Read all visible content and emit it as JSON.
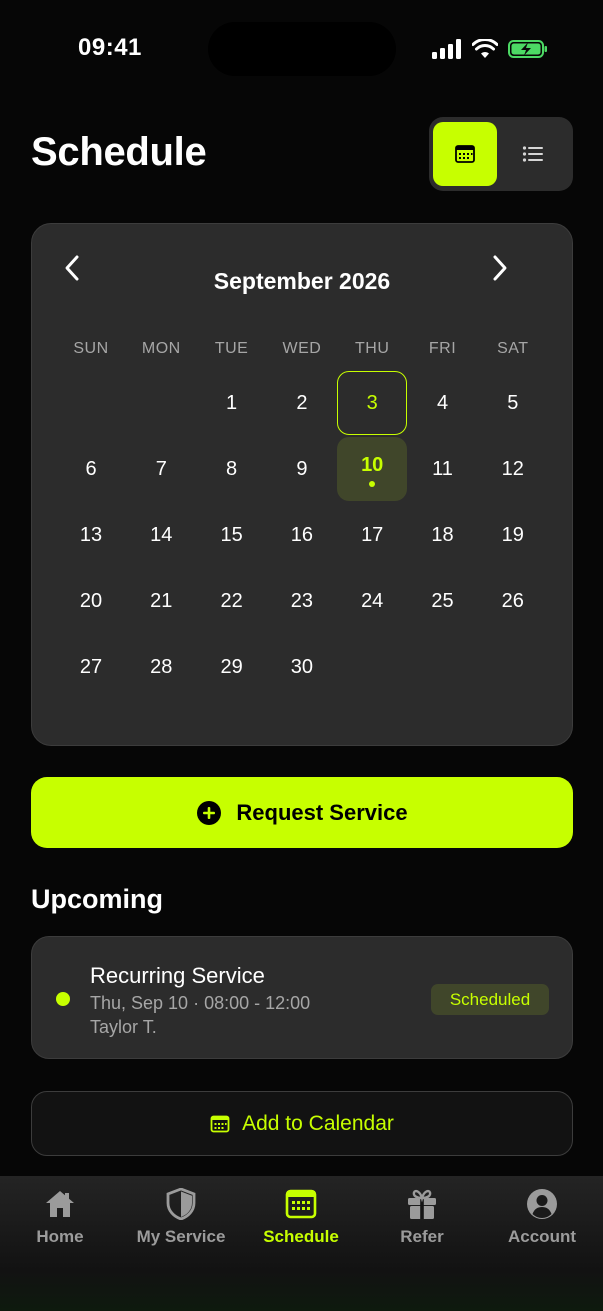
{
  "status_bar": {
    "time": "09:41"
  },
  "header": {
    "title": "Schedule"
  },
  "calendar": {
    "month_label": "September 2026",
    "weekdays": [
      "SUN",
      "MON",
      "TUE",
      "WED",
      "THU",
      "FRI",
      "SAT"
    ],
    "first_weekday_index": 2,
    "days_in_month": 30,
    "today": 3,
    "selected": 10,
    "days_with_events": [
      10
    ]
  },
  "actions": {
    "request_service_label": "Request Service",
    "add_to_calendar_label": "Add to Calendar"
  },
  "upcoming": {
    "title": "Upcoming",
    "events": [
      {
        "title": "Recurring Service",
        "time": "Thu, Sep 10 · 08:00 - 12:00",
        "person": "Taylor T.",
        "status": "Scheduled"
      }
    ]
  },
  "tab_bar": {
    "tabs": [
      {
        "label": "Home",
        "icon": "home-icon"
      },
      {
        "label": "My Service",
        "icon": "shield-icon"
      },
      {
        "label": "Schedule",
        "icon": "calendar-icon",
        "active": true
      },
      {
        "label": "Refer",
        "icon": "gift-icon"
      },
      {
        "label": "Account",
        "icon": "user-icon"
      }
    ]
  },
  "colors": {
    "accent": "#C7FF00",
    "background": "#060606",
    "card": "#2C2C2C"
  }
}
